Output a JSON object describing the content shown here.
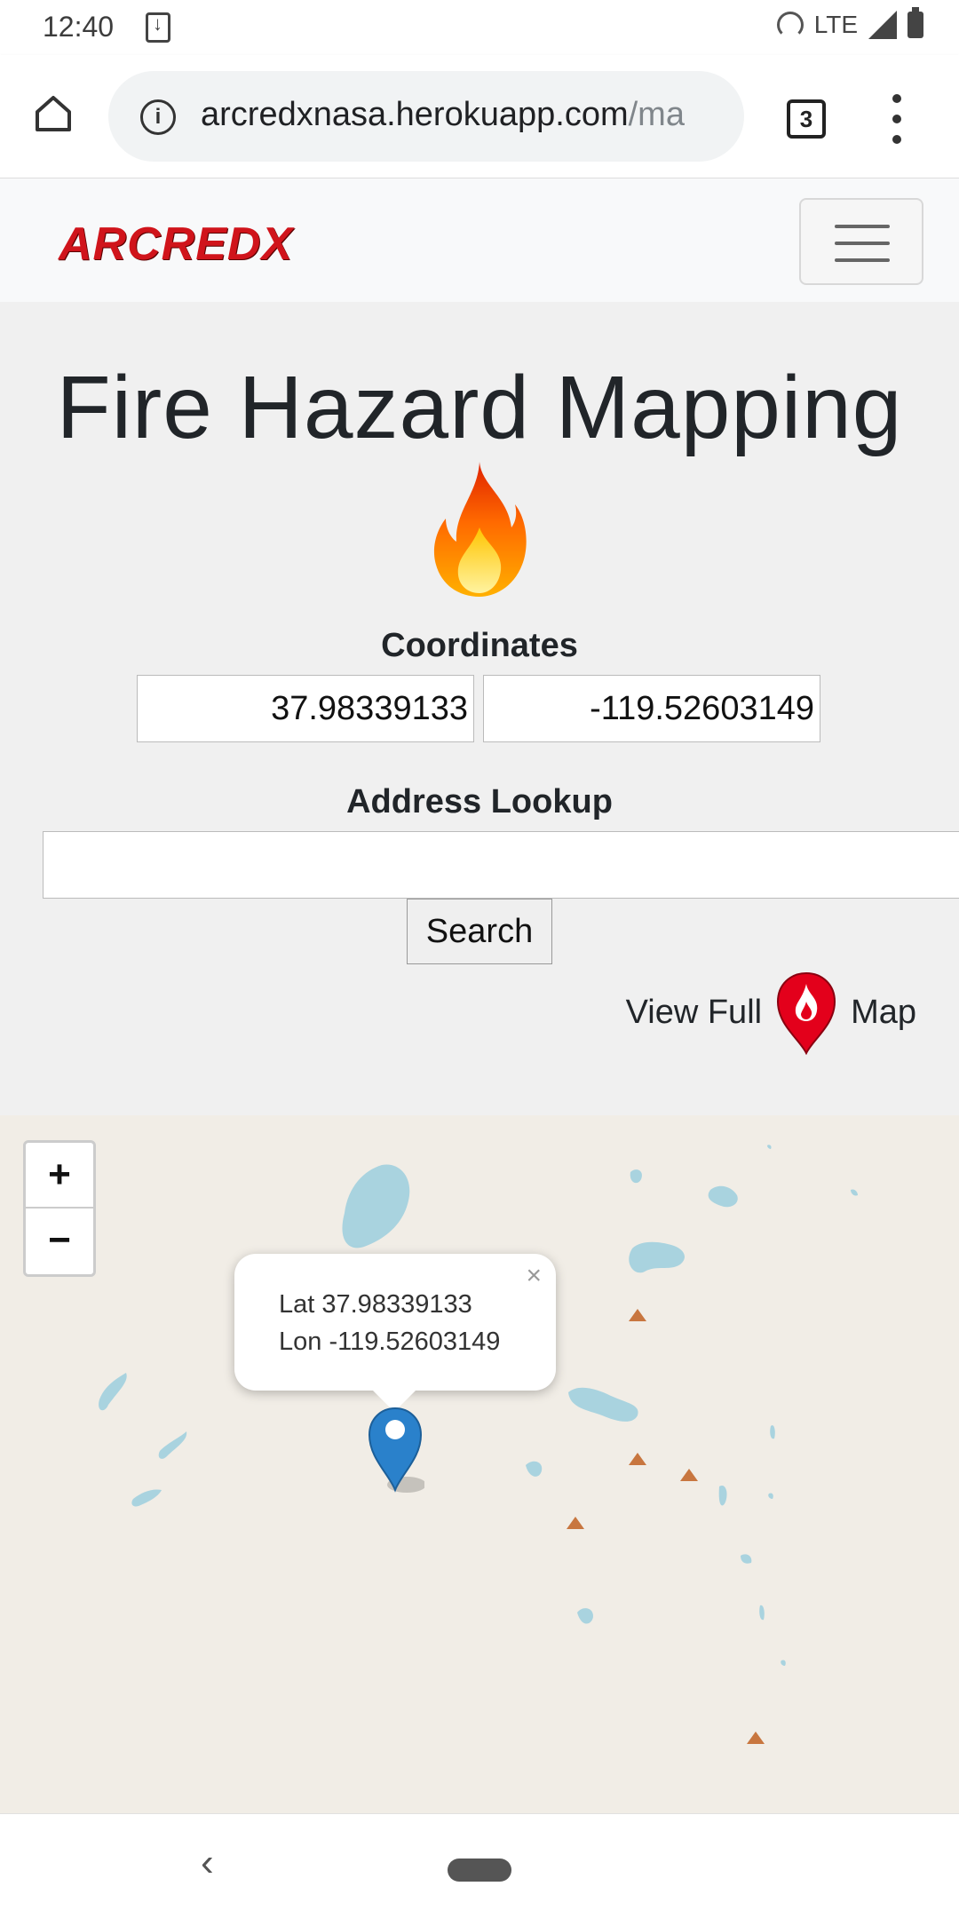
{
  "status_bar": {
    "time": "12:40",
    "network": "LTE",
    "icons": [
      "download-icon",
      "hotspot-icon",
      "signal-icon",
      "battery-icon"
    ]
  },
  "browser": {
    "url_host": "arcredxnasa.herokuapp.com",
    "url_path": "/ma",
    "tab_count": "3",
    "icons": [
      "home-icon",
      "info-icon",
      "kebab-menu-icon"
    ]
  },
  "site": {
    "logo": "ARCREDX",
    "title": "Fire Hazard Mapping",
    "coordinates_label": "Coordinates",
    "latitude_value": "37.98339133",
    "longitude_value": "-119.52603149",
    "address_label": "Address Lookup",
    "address_value": "",
    "search_label": "Search",
    "full_map_prefix": "View Full",
    "full_map_suffix": "Map"
  },
  "map": {
    "zoom_in": "+",
    "zoom_out": "−",
    "popup_lat": "Lat 37.98339133",
    "popup_lon": "Lon -119.52603149",
    "popup_close": "×",
    "water_color": "#a9d3df",
    "peak_color": "#c8763f",
    "marker_color": "#2a81cb"
  },
  "system_nav": {
    "back": "‹"
  }
}
